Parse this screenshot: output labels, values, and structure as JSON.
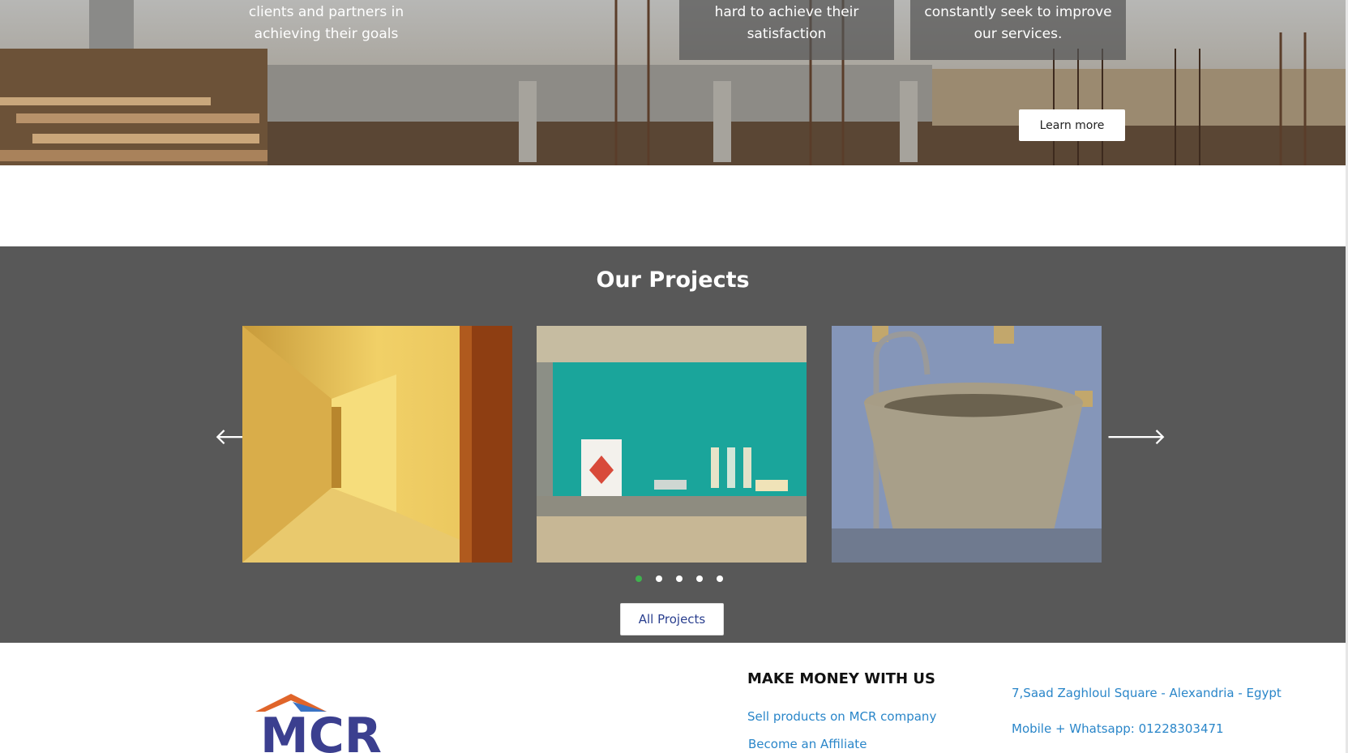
{
  "hero": {
    "cards": [
      {
        "line1": "clients and partners in",
        "line2": "achieving their goals"
      },
      {
        "line1": "hard to achieve their",
        "line2": "satisfaction"
      },
      {
        "line1": "constantly seek to improve",
        "line2": "our services."
      }
    ],
    "learn_more_label": "Learn more"
  },
  "projects": {
    "title": "Our Projects",
    "prev_glyph": "🡐",
    "next_glyph": "🡒",
    "slides": [
      {
        "subject": "hotel-corridor"
      },
      {
        "subject": "bathroom-shelf"
      },
      {
        "subject": "stone-basin"
      }
    ],
    "dots": {
      "count": 5,
      "active_index": 0
    },
    "all_projects_label": "All Projects",
    "colors": {
      "background": "#585858",
      "active_dot": "#3fb24e"
    }
  },
  "footer": {
    "logo_text": "MCR",
    "make_money": {
      "title": "MAKE MONEY WITH US",
      "links": [
        "Sell products on MCR company",
        "Become an Affiliate"
      ]
    },
    "contact": {
      "address": "7,Saad Zaghloul Square - Alexandria - Egypt",
      "mobile": "Mobile + Whatsapp: 01228303471"
    },
    "colors": {
      "link": "#2a86c9",
      "logo_blue": "#3b3f8f",
      "logo_orange": "#e0652a"
    }
  }
}
